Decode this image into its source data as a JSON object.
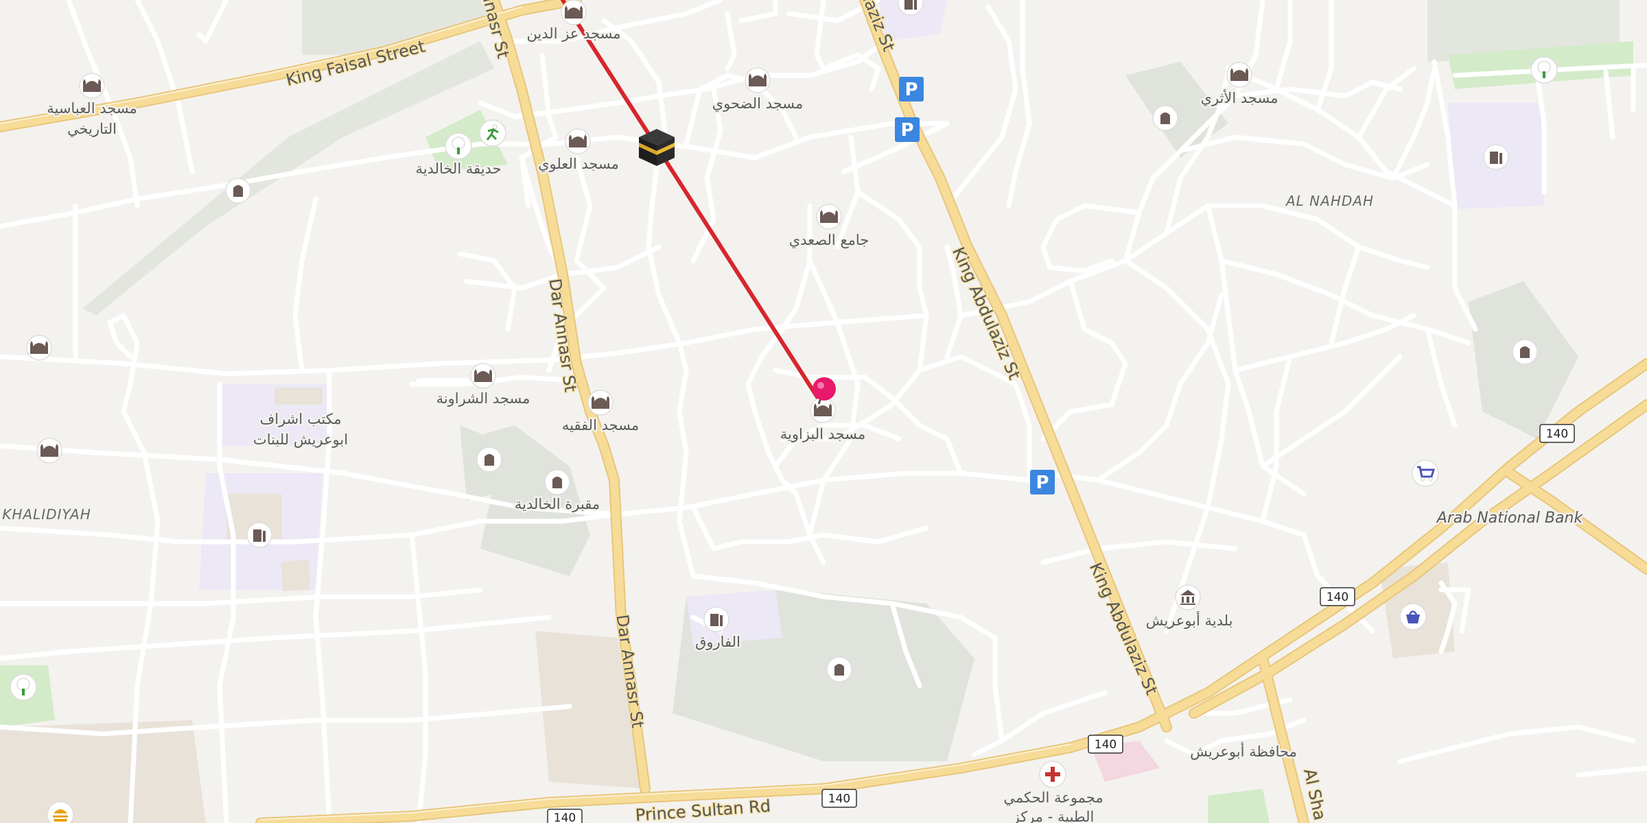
{
  "map": {
    "roads": {
      "king_faisal": "King Faisal Street",
      "dar_annasr_a": "Dar Annasr St",
      "dar_annasr_b": "Dar Annasr St",
      "dar_annasr_top": "Annasr St",
      "king_abdulaziz_a": "King Abdulaziz St",
      "king_abdulaziz_b": "King Abdulaziz St",
      "king_abdulaziz_top": "ulaziz St",
      "prince_sultan": "Prince Sultan Rd",
      "al_sha": "Al Sha"
    },
    "route_shields": [
      "140",
      "140",
      "140",
      "140",
      "140"
    ],
    "districts": {
      "al_nahdah": "AL NAHDAH",
      "khalidiyah": "KHALIDIYAH"
    },
    "places": {
      "mosque_izz": "مسجد عز الدين",
      "mosque_abbasiya_1": "مسجد العباسية",
      "mosque_abbasiya_2": "التاريخي",
      "mosque_dahwi": "مسجد الضحوي",
      "mosque_alawi": "مسجد العلوي",
      "park_khalidiya": "حديقة الخالدية",
      "mosque_athri": "مسجد الأثري",
      "jami_saadi": "جامع الصعدي",
      "mosque_sharawna": "مسجد الشراونة",
      "office_1": "مكتب اشراف",
      "office_2": "ابوعريش للبنات",
      "mosque_faqih": "مسجد الفقيه",
      "mosque_bazawiya": "مسجد البزاوية",
      "cemetery": "مقبرة الخالدية",
      "faruq": "الفاروق",
      "municipality": "بلدية أبوعريش",
      "governorate": "محافظة أبوعريش",
      "medical_1": "مجموعة الحكمي",
      "medical_2": "الطبية - مركز",
      "arab_bank": "Arab National Bank"
    },
    "icons": [
      "kaaba-icon",
      "map-pin-icon",
      "mosque-icon",
      "parking-icon",
      "park-tree-icon",
      "school-icon",
      "cemetery-icon",
      "shopping-cart-icon",
      "shopping-bag-icon",
      "hospital-icon",
      "government-icon",
      "fast-food-icon",
      "sports-icon"
    ],
    "colors": {
      "route": "#d7262e",
      "pin": "#e8186b",
      "major_road": "#f6d88f",
      "parking": "#3b86e0"
    }
  }
}
